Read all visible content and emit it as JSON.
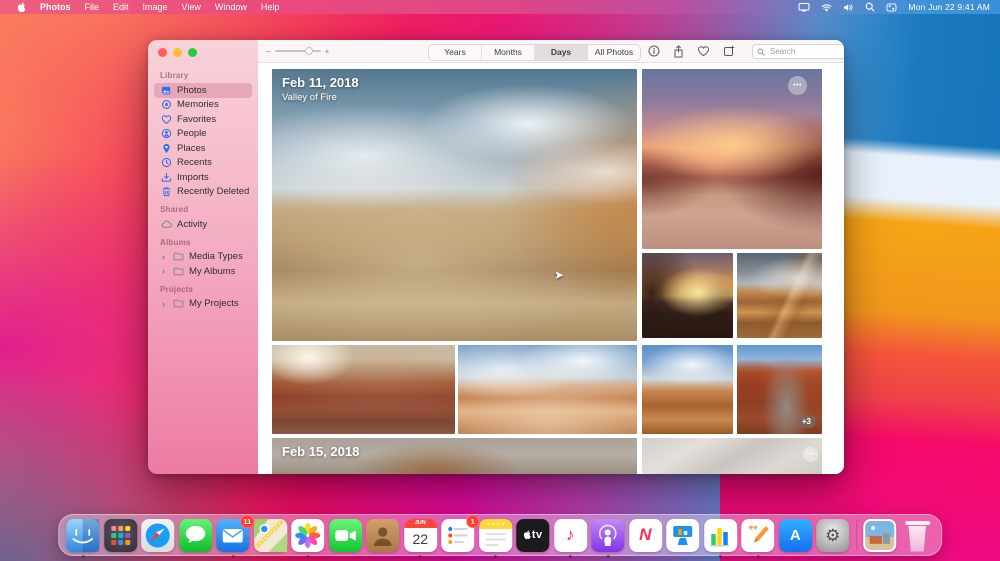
{
  "menu_bar": {
    "items": [
      "Photos",
      "File",
      "Edit",
      "Image",
      "View",
      "Window",
      "Help"
    ],
    "clock": "Mon Jun 22  9:41 AM",
    "status_icons": [
      "display-icon",
      "wifi-icon",
      "volume-icon",
      "spotlight-search-icon",
      "control-center-icon"
    ]
  },
  "toolbar": {
    "segments": [
      "Years",
      "Months",
      "Days",
      "All Photos"
    ],
    "selected_segment": "Days",
    "search_placeholder": "Search",
    "action_icons": [
      "info-icon",
      "share-icon",
      "favorite-heart-icon",
      "add-icon"
    ]
  },
  "sidebar": {
    "selected_item": "Photos",
    "sections": [
      {
        "title": "Library",
        "items": [
          {
            "label": "Photos",
            "icon": "photos-stack-icon"
          },
          {
            "label": "Memories",
            "icon": "memories-icon"
          },
          {
            "label": "Favorites",
            "icon": "heart-icon"
          },
          {
            "label": "People",
            "icon": "person-icon"
          },
          {
            "label": "Places",
            "icon": "map-pin-icon"
          },
          {
            "label": "Recents",
            "icon": "clock-icon"
          },
          {
            "label": "Imports",
            "icon": "import-tray-icon"
          },
          {
            "label": "Recently Deleted",
            "icon": "trash-icon"
          }
        ]
      },
      {
        "title": "Shared",
        "items": [
          {
            "label": "Activity",
            "icon": "cloud-icon"
          }
        ]
      },
      {
        "title": "Albums",
        "items": [
          {
            "label": "Media Types",
            "icon": "folder-icon"
          },
          {
            "label": "My Albums",
            "icon": "folder-icon"
          }
        ]
      },
      {
        "title": "Projects",
        "items": [
          {
            "label": "My Projects",
            "icon": "folder-icon"
          }
        ]
      }
    ]
  },
  "content": {
    "group1": {
      "date": "Feb 11, 2018",
      "location": "Valley of Fire",
      "overflow_badge": "+3"
    },
    "group2": {
      "date": "Feb 15, 2018"
    }
  },
  "icons": {
    "more": "•••",
    "minus": "−",
    "plus": "+",
    "chevron": "›"
  },
  "dock": {
    "items": [
      "finder-icon",
      "launchpad-icon",
      "safari-icon",
      "messages-icon",
      "mail-icon",
      "maps-icon",
      "photos-icon",
      "facetime-icon",
      "contacts-icon",
      "calendar-icon",
      "reminders-icon",
      "notes-icon",
      "tv-icon",
      "music-icon",
      "podcasts-icon",
      "news-icon",
      "keynote-icon",
      "numbers-icon",
      "pages-icon",
      "app-store-icon",
      "system-preferences-icon",
      "photo-stack-icon",
      "trash-icon"
    ],
    "calendar": {
      "month": "JUN",
      "day": "22"
    },
    "badges": {
      "mail": "11",
      "reminders": "1"
    },
    "labels": {
      "tv": "tv",
      "music": "♪",
      "news": "N",
      "appstore": "A",
      "gear": "⚙"
    }
  },
  "colors": {
    "accent_blue": "#2e6ef0",
    "badge_red": "#ff3b30",
    "traffic_red": "#ff5f58",
    "traffic_yellow": "#febc2e",
    "traffic_green": "#28c83f"
  }
}
